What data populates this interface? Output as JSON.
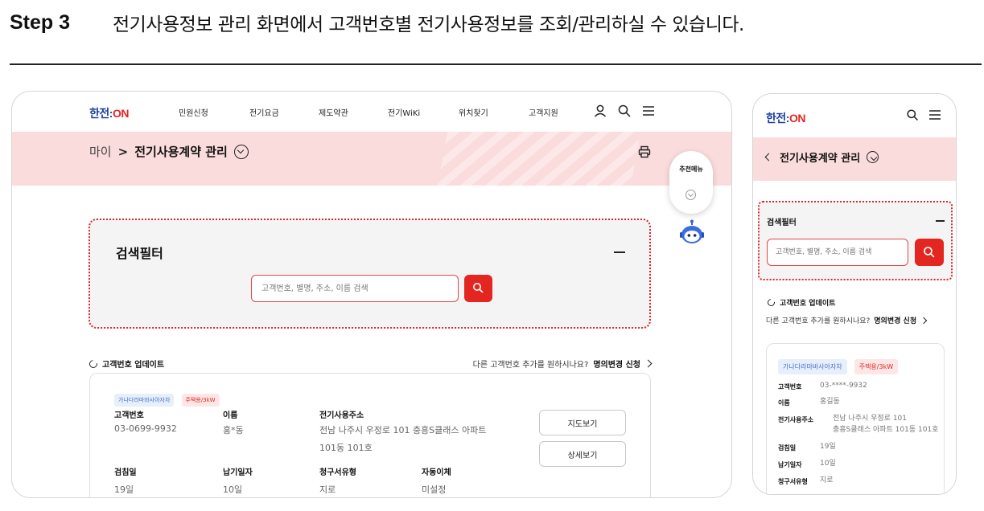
{
  "header": {
    "step_label": "Step 3",
    "step_text": "전기사용정보 관리 화면에서 고객번호별 전기사용정보를 조회/관리하실 수 있습니다."
  },
  "brand": {
    "logo_prefix": "한전:",
    "logo_on": "ON",
    "primary": "#e3261f",
    "navy": "#1a3fa0",
    "band": "#fbdcdc"
  },
  "nav": {
    "items": [
      "민원신청",
      "전기요금",
      "제도약관",
      "전기WiKi",
      "위치찾기",
      "고객지원"
    ],
    "icons": [
      "user-icon",
      "search-icon",
      "menu-icon"
    ]
  },
  "breadcrumb": {
    "home": "마이",
    "current": "전기사용계약 관리"
  },
  "filter": {
    "title": "검색필터",
    "placeholder": "고객번호, 별명, 주소, 이름 검색"
  },
  "update": {
    "label": "고객번호 업데이트",
    "ask": "다른 고객번호 추가를 원하시나요?",
    "link": "명의변경 신청"
  },
  "floating": {
    "label": "추천메뉴"
  },
  "desktop_card": {
    "badges": [
      "가나다라마바사아자차",
      "주택용/3kW"
    ],
    "fields": {
      "customer_no_label": "고객번호",
      "customer_no": "03-0699-9932",
      "name_label": "이름",
      "name": "홍*동",
      "address_label": "전기사용주소",
      "address_line1": "전남 나주시 우정로 101 충흥S클래스 아파트",
      "address_line2": "101동 101호",
      "meter_day_label": "검침일",
      "meter_day": "19일",
      "due_label": "납기일자",
      "due": "10일",
      "bill_type_label": "청구서유형",
      "bill_type": "지로",
      "autopay_label": "자동이체",
      "autopay": "미설정"
    },
    "buttons": {
      "map": "지도보기",
      "detail": "상세보기"
    }
  },
  "mobile_card": {
    "badges": [
      "가나다라마바사아자차",
      "주택용/3kW"
    ],
    "fields": {
      "customer_no_label": "고객번호",
      "customer_no": "03-****-9932",
      "name_label": "이름",
      "name": "홍길동",
      "address_label": "전기사용주소",
      "address_line1": "전남 나주시 우정로 101",
      "address_line2": "충흥S클래스 아파트 101동 101호",
      "meter_day_label": "검침일",
      "meter_day": "19일",
      "due_label": "납기일자",
      "due": "10일",
      "bill_type_label": "청구서유형",
      "bill_type": "지로"
    }
  }
}
